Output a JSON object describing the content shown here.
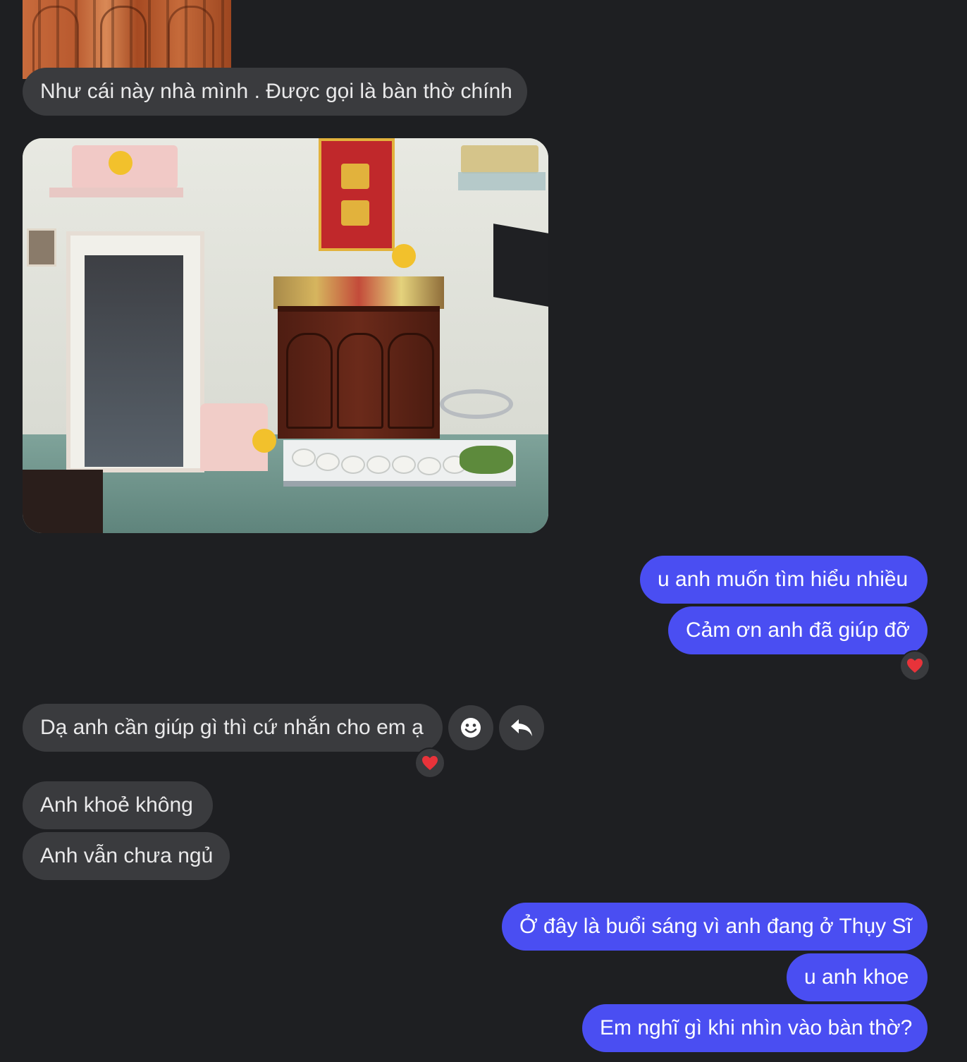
{
  "messages": {
    "m1": "Như cái này nhà mình . Được gọi là bàn thờ chính",
    "m2": "u anh muốn tìm hiểu nhiều",
    "m3": "Cảm ơn anh đã giúp đỡ",
    "m4": "Dạ anh cần giúp gì thì cứ nhắn cho em ạ",
    "m5": "Anh khoẻ không",
    "m6": "Anh vẫn chưa ngủ",
    "m7": "Ở đây là buổi sáng vì anh đang ở Thụy Sĩ",
    "m8": "u anh khoe",
    "m9": "Em nghĩ gì khi nhìn vào bàn thờ?"
  },
  "reactions": {
    "m3": "heart-icon",
    "m4": "heart-icon"
  },
  "hover_actions": [
    "emoji-react-icon",
    "reply-icon"
  ],
  "colors": {
    "background": "#1e1f22",
    "incoming_bubble": "#3a3b3e",
    "outgoing_bubble": "#4a4ef2",
    "heart": "#e8333a"
  }
}
